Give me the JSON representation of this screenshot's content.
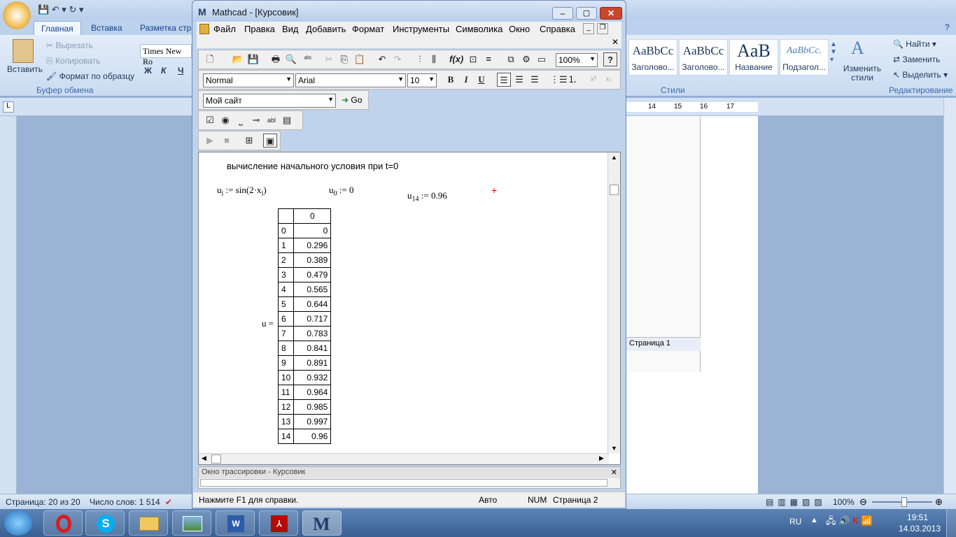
{
  "word": {
    "tabs": [
      "Главная",
      "Вставка",
      "Разметка стра"
    ],
    "clipboard": {
      "paste": "Вставить",
      "cut": "Вырезать",
      "copy": "Копировать",
      "format_painter": "Формат по образцу",
      "group": "Буфер обмена"
    },
    "font_name": "Times New Ro",
    "font_buttons": [
      "Ж",
      "К",
      "Ч"
    ],
    "styles": [
      {
        "sample": "AaBbCc",
        "name": "Заголово..."
      },
      {
        "sample": "AaBbCc",
        "name": "Заголово..."
      },
      {
        "sample": "AaB",
        "name": "Название"
      },
      {
        "sample": "AaBbCc.",
        "name": "Подзагол..."
      }
    ],
    "change_styles": "Изменить стили",
    "styles_group": "Стили",
    "editing": {
      "find": "Найти",
      "replace": "Заменить",
      "select": "Выделить",
      "group": "Редактирование"
    },
    "ruler_numbers": [
      "14",
      "15",
      "16",
      "17"
    ],
    "nav_page": "Страница 1",
    "status": {
      "page": "Страница: 20 из 20",
      "words": "Число слов: 1 514",
      "zoom": "100%"
    }
  },
  "mathcad": {
    "title": "Mathcad - [Курсовик]",
    "menu": [
      "Файл",
      "Правка",
      "Вид",
      "Добавить",
      "Формат",
      "Инструменты",
      "Символика",
      "Окно",
      "Справка"
    ],
    "zoom": "100%",
    "style": "Normal",
    "font": "Arial",
    "size": "10",
    "site": "Мой сайт",
    "go": "Go",
    "worksheet": {
      "heading": "вычисление начального условия при t=0",
      "def_u": "u",
      "def_sub_i": "i",
      "def_rhs": ":= sin(2·x",
      "def_end": ")",
      "u0_def": "u",
      "u0_sub": "0",
      "u0_rhs": ":= 0",
      "u14_def": "u",
      "u14_sub": "14",
      "u14_rhs": ":= 0.96",
      "u_label": "u =",
      "table_header": "0",
      "rows": [
        {
          "i": "0",
          "v": "0"
        },
        {
          "i": "1",
          "v": "0.296"
        },
        {
          "i": "2",
          "v": "0.389"
        },
        {
          "i": "3",
          "v": "0.479"
        },
        {
          "i": "4",
          "v": "0.565"
        },
        {
          "i": "5",
          "v": "0.644"
        },
        {
          "i": "6",
          "v": "0.717"
        },
        {
          "i": "7",
          "v": "0.783"
        },
        {
          "i": "8",
          "v": "0.841"
        },
        {
          "i": "9",
          "v": "0.891"
        },
        {
          "i": "10",
          "v": "0.932"
        },
        {
          "i": "11",
          "v": "0.964"
        },
        {
          "i": "12",
          "v": "0.985"
        },
        {
          "i": "13",
          "v": "0.997"
        },
        {
          "i": "14",
          "v": "0.96"
        }
      ]
    },
    "trace_title": "Окно трассировки - Курсовик",
    "status": {
      "help": "Нажмите F1 для справки.",
      "mode": "Авто",
      "num": "NUM",
      "page": "Страница 2"
    }
  },
  "taskbar": {
    "lang": "RU",
    "time": "19:51",
    "date": "14.03.2013"
  }
}
